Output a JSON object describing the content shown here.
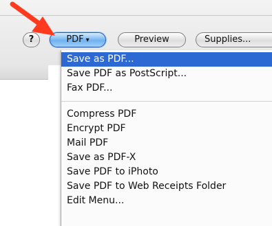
{
  "colors": {
    "pointer_arrow": "#ff3b1f",
    "selection": "#2c69d3",
    "pdf_button": "#6fb1ef"
  },
  "toolbar": {
    "help_label": "?",
    "pdf_label": "PDF",
    "pdf_caret": "▾",
    "preview_label": "Preview",
    "supplies_label": "Supplies..."
  },
  "menu": {
    "items": [
      "Save as PDF...",
      "Save PDF as PostScript...",
      "Fax PDF...",
      "Compress PDF",
      "Encrypt PDF",
      "Mail PDF",
      "Save as PDF-X",
      "Save PDF to iPhoto",
      "Save PDF to Web Receipts Folder",
      "Edit Menu..."
    ],
    "selected_index": 0
  },
  "icons": {
    "pointer": "red-arrow-icon"
  }
}
